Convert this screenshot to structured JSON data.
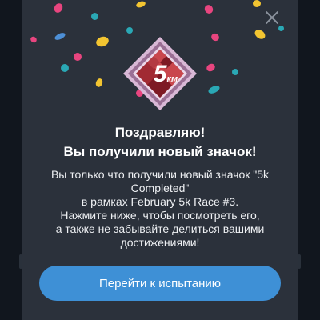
{
  "dialog": {
    "badge": {
      "number": "5",
      "unit": "км",
      "icon": "5k-badge-icon",
      "colors": {
        "outer": "#d9b8d6",
        "mid": "#9b6f95",
        "inner_dark": "#7e1a24",
        "inner_light": "#c9464c"
      }
    },
    "title_line1": "Поздравляю!",
    "title_line2": "Вы получили новый значок!",
    "body_lines": [
      "Вы только что получили новый значок \"5k",
      "Completed\"",
      "в рамках February 5k Race #3.",
      "Нажмите ниже, чтобы посмотреть его,",
      "а также не забывайте делиться вашими",
      "достижениями!"
    ],
    "cta_label": "Перейти к испытанию",
    "close_icon": "close-icon"
  },
  "colors": {
    "modal_bg": "#2b313b",
    "backdrop": "#11161e",
    "accent": "#3e90d6",
    "confetti": [
      "#e8457f",
      "#f3c531",
      "#2aa8b5",
      "#4d8fd6"
    ]
  }
}
